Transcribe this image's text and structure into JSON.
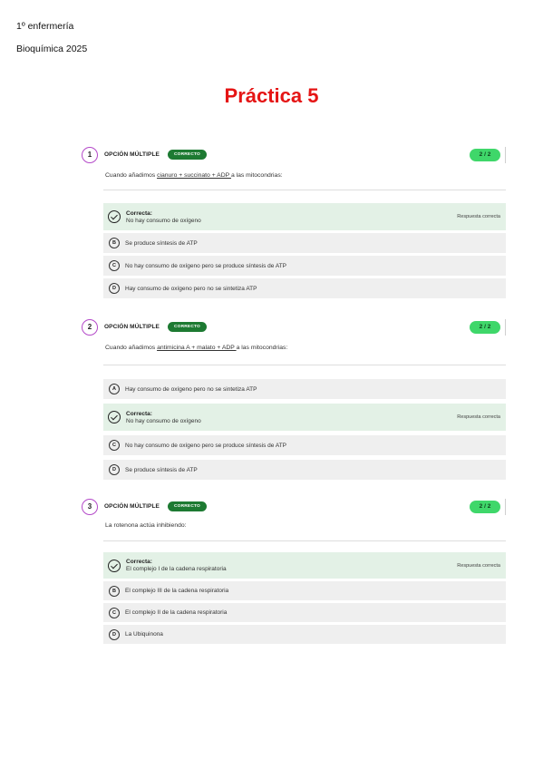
{
  "header": {
    "course": "1º enfermería",
    "subject": "Bioquímica 2025",
    "title": "Práctica 5"
  },
  "colors": {
    "title": "#e51515",
    "number_ring": "#b44ac9",
    "badge": "#1d7a32",
    "score": "#3fd76a",
    "correct_bg": "#e3f1e6",
    "option_bg": "#efefef"
  },
  "questions": [
    {
      "number": "1",
      "type": "OPCIÓN MÚLTIPLE",
      "badge": "CORRECTO",
      "score": "2 / 2",
      "prompt_pre": "Cuando añadimos ",
      "prompt_u": "cianuro + succinato + ADP ",
      "prompt_post": "a las mitocondrias:",
      "options": [
        {
          "correct": true,
          "label": "Correcta:",
          "text": "No hay consumo de oxígeno",
          "note": "Respuesta correcta",
          "icon": "check-circle-icon"
        },
        {
          "letter": "B",
          "text": "Se produce síntesis de ATP"
        },
        {
          "letter": "C",
          "text": "No hay consumo de oxígeno pero se produce síntesis de ATP"
        },
        {
          "letter": "D",
          "text": "Hay consumo de oxígeno pero no se sintetiza ATP"
        }
      ]
    },
    {
      "number": "2",
      "type": "OPCIÓN MÚLTIPLE",
      "badge": "CORRECTO",
      "score": "2 / 2",
      "prompt_pre": "Cuando añadimos ",
      "prompt_u": "antimicina A + malato + ADP ",
      "prompt_post": "a las mitocondrias:",
      "options": [
        {
          "letter": "A",
          "text": "Hay consumo de oxígeno pero no se sintetiza ATP"
        },
        {
          "correct": true,
          "label": "Correcta:",
          "text": "No hay consumo de oxígeno",
          "note": "Respuesta correcta",
          "icon": "check-circle-icon"
        },
        {
          "letter": "C",
          "text": "No hay consumo de oxígeno pero se produce síntesis de ATP"
        },
        {
          "letter": "D",
          "text": "Se produce síntesis de ATP"
        }
      ]
    },
    {
      "number": "3",
      "type": "OPCIÓN MÚLTIPLE",
      "badge": "CORRECTO",
      "score": "2 / 2",
      "prompt": "La rotenona actúa inhibiendo:",
      "options": [
        {
          "correct": true,
          "label": "Correcta:",
          "text": "El complejo I de la cadena respiratoria",
          "note": "Respuesta correcta",
          "icon": "check-circle-icon"
        },
        {
          "letter": "B",
          "text": "El complejo III de la cadena respiratoria"
        },
        {
          "letter": "C",
          "text": "El complejo II de la cadena respiratoria"
        },
        {
          "letter": "D",
          "text": "La Ubiquinona"
        }
      ]
    }
  ]
}
